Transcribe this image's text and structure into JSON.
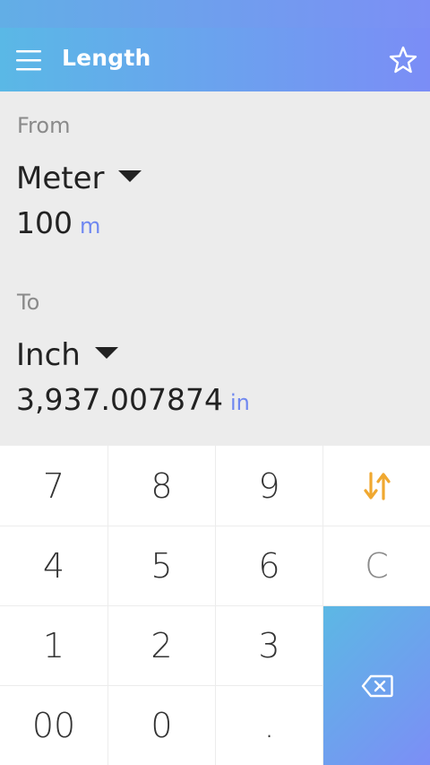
{
  "app_bar": {
    "title": "Length",
    "menu_icon": "hamburger-menu-icon",
    "favorite_icon": "star-outline-icon"
  },
  "from": {
    "label": "From",
    "unit": "Meter",
    "value": "100",
    "symbol": "m"
  },
  "to": {
    "label": "To",
    "unit": "Inch",
    "value": "3,937.007874",
    "symbol": "in"
  },
  "keypad": {
    "keys": [
      "7",
      "8",
      "9",
      "4",
      "5",
      "6",
      "1",
      "2",
      "3",
      "00",
      "0",
      "."
    ],
    "swap_icon": "swap-arrows-icon",
    "clear_label": "C",
    "backspace_icon": "backspace-icon"
  },
  "colors": {
    "accent_start": "#5ab8e6",
    "accent_end": "#7b8df6",
    "swap_orange": "#f0a830",
    "unit_symbol": "#6f87f0",
    "panel_bg": "#ececec"
  }
}
